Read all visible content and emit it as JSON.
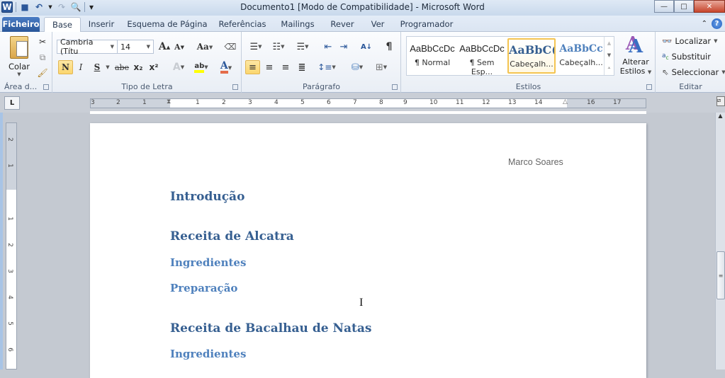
{
  "window": {
    "title": "Documento1 [Modo de Compatibilidade]  -  Microsoft Word",
    "controls": {
      "minimize": "—",
      "maximize": "□",
      "close": "✕"
    }
  },
  "qat": {
    "logo": "W",
    "save": "💾",
    "undo": "↶",
    "redo": "↷",
    "print_preview": "🔍",
    "customize": "▾"
  },
  "tabs": [
    {
      "label": "Ficheiro"
    },
    {
      "label": "Base",
      "active": true
    },
    {
      "label": "Inserir"
    },
    {
      "label": "Esquema de Página"
    },
    {
      "label": "Referências"
    },
    {
      "label": "Mailings"
    },
    {
      "label": "Rever"
    },
    {
      "label": "Ver"
    },
    {
      "label": "Programador"
    }
  ],
  "ribbon": {
    "clipboard": {
      "paste_label": "Colar",
      "group_label": "Área d..."
    },
    "font": {
      "font_name": "Cambria (Títu",
      "font_size": "14",
      "bold": "N",
      "italic": "I",
      "underline": "S",
      "strikethrough": "abe",
      "subscript": "x₂",
      "superscript": "x²",
      "grow": "A",
      "shrink": "A",
      "change_case": "Aa",
      "group_label": "Tipo de Letra"
    },
    "paragraph": {
      "pilcrow": "¶",
      "sort": "A↓",
      "group_label": "Parágrafo"
    },
    "styles": {
      "items": [
        {
          "preview": "AaBbCcDc",
          "name": "¶ Normal"
        },
        {
          "preview": "AaBbCcDc",
          "name": "¶ Sem Esp..."
        },
        {
          "preview": "AaBbC(",
          "name": "Cabeçalh...",
          "selected": true
        },
        {
          "preview": "AaBbCc",
          "name": "Cabeçalh..."
        }
      ],
      "change_styles": "Alterar",
      "change_styles2": "Estilos",
      "group_label": "Estilos"
    },
    "editing": {
      "find": "Localizar",
      "replace": "Substituir",
      "select": "Seleccionar",
      "group_label": "Editar"
    }
  },
  "ruler": {
    "tab_selector": "L",
    "labels": [
      "3",
      "2",
      "1",
      "1",
      "2",
      "3",
      "4",
      "5",
      "6",
      "7",
      "8",
      "9",
      "10",
      "11",
      "12",
      "13",
      "14",
      "16",
      "17"
    ],
    "vertical_labels": [
      "2",
      "1",
      "1",
      "2",
      "3",
      "4",
      "5",
      "6"
    ]
  },
  "document": {
    "header_author": "Marco Soares",
    "headings": [
      {
        "text": "Introdução",
        "level": 1
      },
      {
        "text": "Receita de Alcatra",
        "level": 1
      },
      {
        "text": "Ingredientes",
        "level": 2
      },
      {
        "text": "Preparação",
        "level": 2
      },
      {
        "text": "Receita de Bacalhau de Natas",
        "level": 1
      },
      {
        "text": "Ingredientes",
        "level": 2
      }
    ]
  },
  "colors": {
    "heading1": "#365f91",
    "heading2": "#4f81bd",
    "file_tab": "#2a5699",
    "highlight": "#fbd66e"
  }
}
